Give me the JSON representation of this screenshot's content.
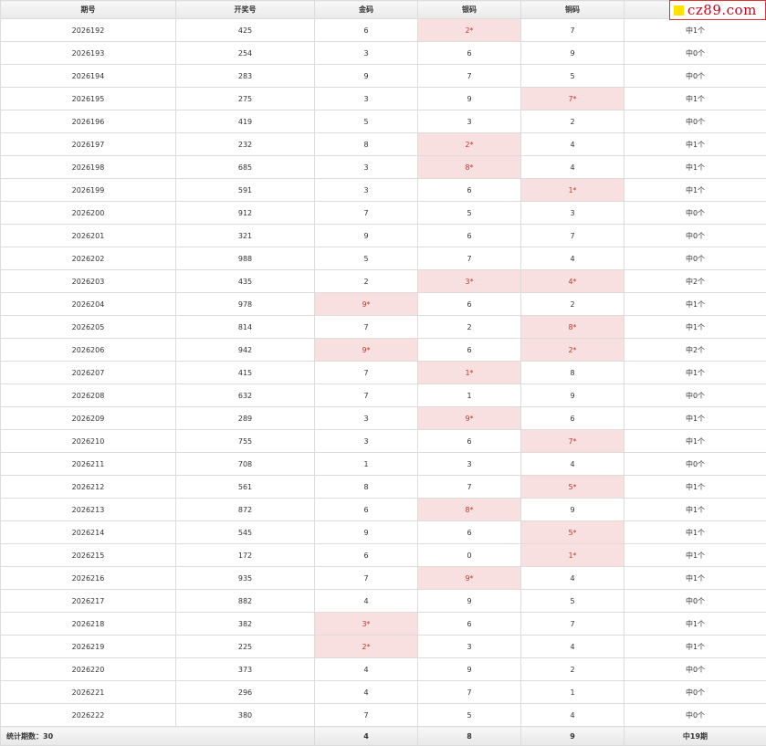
{
  "logo": {
    "text": "cz89.com",
    "colors": {
      "square": "#ffe100",
      "text": "#d0021b"
    }
  },
  "headers": [
    "期号",
    "开奖号",
    "金码",
    "银码",
    "铜码",
    ""
  ],
  "rows": [
    [
      "2026192",
      "425",
      "6",
      "2*",
      "7",
      "中1个"
    ],
    [
      "2026193",
      "254",
      "3",
      "6",
      "9",
      "中0个"
    ],
    [
      "2026194",
      "283",
      "9",
      "7",
      "5",
      "中0个"
    ],
    [
      "2026195",
      "275",
      "3",
      "9",
      "7*",
      "中1个"
    ],
    [
      "2026196",
      "419",
      "5",
      "3",
      "2",
      "中0个"
    ],
    [
      "2026197",
      "232",
      "8",
      "2*",
      "4",
      "中1个"
    ],
    [
      "2026198",
      "685",
      "3",
      "8*",
      "4",
      "中1个"
    ],
    [
      "2026199",
      "591",
      "3",
      "6",
      "1*",
      "中1个"
    ],
    [
      "2026200",
      "912",
      "7",
      "5",
      "3",
      "中0个"
    ],
    [
      "2026201",
      "321",
      "9",
      "6",
      "7",
      "中0个"
    ],
    [
      "2026202",
      "988",
      "5",
      "7",
      "4",
      "中0个"
    ],
    [
      "2026203",
      "435",
      "2",
      "3*",
      "4*",
      "中2个"
    ],
    [
      "2026204",
      "978",
      "9*",
      "6",
      "2",
      "中1个"
    ],
    [
      "2026205",
      "814",
      "7",
      "2",
      "8*",
      "中1个"
    ],
    [
      "2026206",
      "942",
      "9*",
      "6",
      "2*",
      "中2个"
    ],
    [
      "2026207",
      "415",
      "7",
      "1*",
      "8",
      "中1个"
    ],
    [
      "2026208",
      "632",
      "7",
      "1",
      "9",
      "中0个"
    ],
    [
      "2026209",
      "289",
      "3",
      "9*",
      "6",
      "中1个"
    ],
    [
      "2026210",
      "755",
      "3",
      "6",
      "7*",
      "中1个"
    ],
    [
      "2026211",
      "708",
      "1",
      "3",
      "4",
      "中0个"
    ],
    [
      "2026212",
      "561",
      "8",
      "7",
      "5*",
      "中1个"
    ],
    [
      "2026213",
      "872",
      "6",
      "8*",
      "9",
      "中1个"
    ],
    [
      "2026214",
      "545",
      "9",
      "6",
      "5*",
      "中1个"
    ],
    [
      "2026215",
      "172",
      "6",
      "0",
      "1*",
      "中1个"
    ],
    [
      "2026216",
      "935",
      "7",
      "9*",
      "4",
      "中1个"
    ],
    [
      "2026217",
      "882",
      "4",
      "9",
      "5",
      "中0个"
    ],
    [
      "2026218",
      "382",
      "3*",
      "6",
      "7",
      "中1个"
    ],
    [
      "2026219",
      "225",
      "2*",
      "3",
      "4",
      "中1个"
    ],
    [
      "2026220",
      "373",
      "4",
      "9",
      "2",
      "中0个"
    ],
    [
      "2026221",
      "296",
      "4",
      "7",
      "1",
      "中0个"
    ],
    [
      "2026222",
      "380",
      "7",
      "5",
      "4",
      "中0个"
    ]
  ],
  "footer": {
    "label": "统计期数：30",
    "gold": "4",
    "silver": "8",
    "bronze": "9",
    "total": "中19期"
  },
  "colors": {
    "hit_bg": "#f9e0e0",
    "hit_text": "#c0392b"
  }
}
